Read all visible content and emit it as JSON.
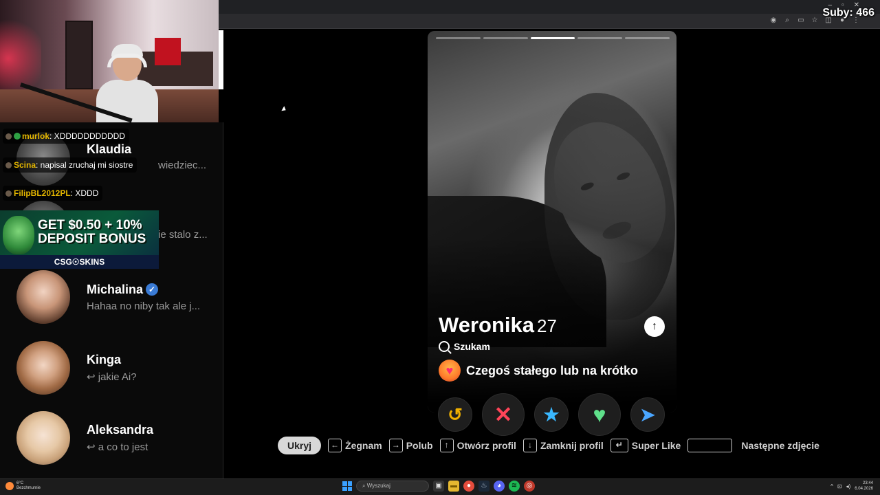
{
  "overlay": {
    "subs_label": "Suby: 466"
  },
  "chat": [
    {
      "user": "murlok",
      "message": ": XDDDDDDDDDDD",
      "badge": true
    },
    {
      "user": "Scina",
      "message": ": napisal zruchaj mi siostre",
      "badge": false
    },
    {
      "user": "FilipBL2012PL",
      "message": ": XDDD",
      "badge": false
    }
  ],
  "ad": {
    "headline_1": "GET $0.50 + 10%",
    "headline_2": "DEPOSIT BONUS",
    "brand": "CSG☉SKINS"
  },
  "matches": [
    {
      "name": "Klaudia",
      "preview": "wiedziec...",
      "verified": false
    },
    {
      "name": "",
      "preview": "ie stalo z...",
      "verified": false
    },
    {
      "name": "Michalina",
      "preview": "Hahaa no niby tak ale j...",
      "verified": true
    },
    {
      "name": "Kinga",
      "preview": "↩ jakie Ai?",
      "verified": false
    },
    {
      "name": "Aleksandra",
      "preview": "↩ a co to jest",
      "verified": false
    }
  ],
  "profile": {
    "name": "Weronika",
    "age": "27",
    "looking_label": "Szukam",
    "goal": "Czegoś stałego lub na krótko",
    "photo_count": 5,
    "active_photo": 3,
    "expand_icon": "arrow-up-icon"
  },
  "actions": [
    {
      "name": "rewind-button",
      "icon": "rewind-icon",
      "glyph": "↺"
    },
    {
      "name": "nope-button",
      "icon": "x-icon",
      "glyph": "✕"
    },
    {
      "name": "super-like-button",
      "icon": "star-icon",
      "glyph": "★"
    },
    {
      "name": "like-button",
      "icon": "heart-icon",
      "glyph": "♥"
    },
    {
      "name": "boost-button",
      "icon": "send-icon",
      "glyph": "➤"
    }
  ],
  "hints": {
    "hide": "Ukryj",
    "nope": "Żegnam",
    "like": "Polub",
    "open": "Otwórz profil",
    "close": "Zamknij profil",
    "superlike": "Super Like",
    "next": "Następne zdjęcie"
  },
  "taskbar": {
    "weather_temp": "6°C",
    "weather_desc": "Bezchmurnie",
    "search_placeholder": "Wyszukaj",
    "time": "23:44",
    "date": "6.04.2026"
  },
  "colors": {
    "nope": "#ff4458",
    "like": "#5fe08a",
    "super": "#3ab8ff",
    "rewind": "#f0b000"
  }
}
